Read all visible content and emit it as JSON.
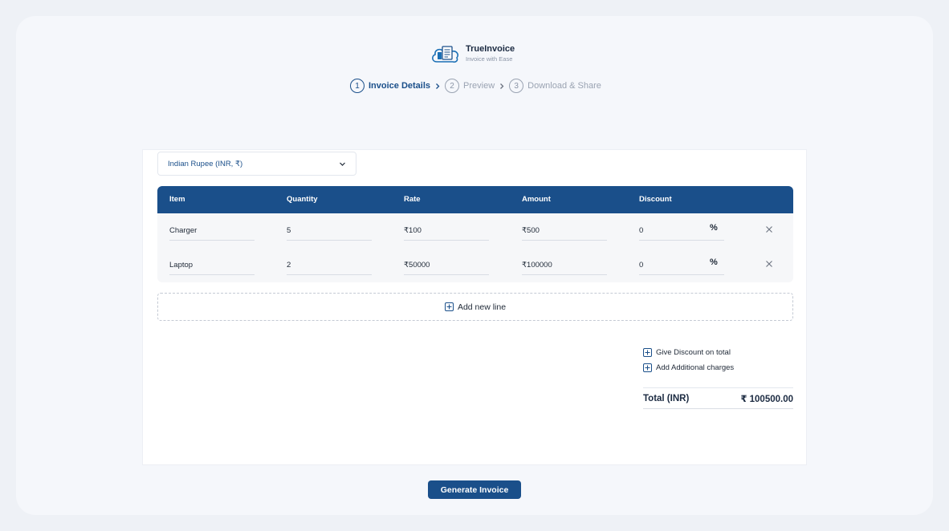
{
  "brand": {
    "name": "TrueInvoice",
    "tagline": "Invoice with Ease",
    "accent": "#1a4f8a"
  },
  "steps": [
    {
      "num": "1",
      "label": "Invoice Details",
      "active": true
    },
    {
      "num": "2",
      "label": "Preview",
      "active": false
    },
    {
      "num": "3",
      "label": "Download & Share",
      "active": false
    }
  ],
  "currency": {
    "selected": "Indian Rupee (INR, ₹)"
  },
  "table": {
    "headers": [
      "Item",
      "Quantity",
      "Rate",
      "Amount",
      "Discount"
    ],
    "rows": [
      {
        "item": "Charger",
        "quantity": "5",
        "rate": "₹100",
        "amount": "₹500",
        "discount": "0",
        "discount_type": "%"
      },
      {
        "item": "Laptop",
        "quantity": "2",
        "rate": "₹50000",
        "amount": "₹100000",
        "discount": "0",
        "discount_type": "%"
      }
    ]
  },
  "add_line_label": "Add new line",
  "extras": {
    "discount_label": "Give Discount on total",
    "charges_label": "Add Additional charges"
  },
  "total": {
    "label": "Total (INR)",
    "value": "₹ 100500.00"
  },
  "generate_label": "Generate Invoice"
}
